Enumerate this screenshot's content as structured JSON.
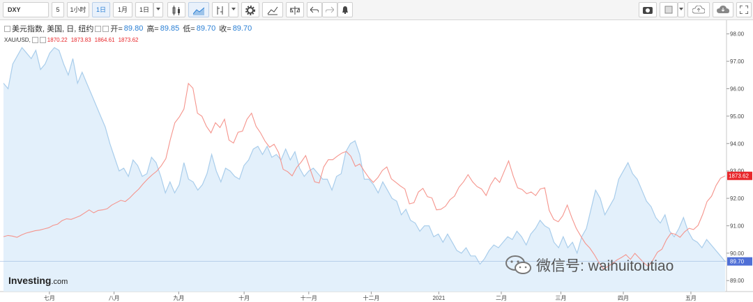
{
  "toolbar": {
    "symbol": "DXY",
    "buttons": [
      "5",
      "1小时",
      "1日",
      "1月",
      "1日"
    ]
  },
  "legend": {
    "dxy_name": "美元指数, 美国, 日, 纽约",
    "dxy_open_label": "开=",
    "dxy_open": "89.80",
    "dxy_high_label": "高=",
    "dxy_high": "89.85",
    "dxy_low_label": "低=",
    "dxy_low": "89.70",
    "dxy_close_label": "收=",
    "dxy_close": "89.70",
    "xau_name": "XAU/USD,",
    "xau_open": "1870.22",
    "xau_high": "1873.83",
    "xau_low": "1864.61",
    "xau_close": "1873.62"
  },
  "watermark": "微信号: waihuitoutiao",
  "logo": {
    "main": "Investing",
    "suffix": ".com"
  },
  "colors": {
    "dxy_line": "#a9cdeb",
    "dxy_fill": "#e3f0fb",
    "xau_line": "#f5948c",
    "dxy_tag": "#4f6fd6",
    "xau_tag": "#e8262a",
    "accent": "#2a7fd4"
  },
  "chart_data": {
    "type": "area",
    "x_labels": [
      "七月",
      "八月",
      "九月",
      "十月",
      "十一月",
      "十二月",
      "2021",
      "二月",
      "三月",
      "四月",
      "五月"
    ],
    "yaxis_ticks": [
      "98.00",
      "97.00",
      "96.00",
      "95.00",
      "94.00",
      "93.00",
      "92.00",
      "91.00",
      "90.00",
      "89.00"
    ],
    "ylim": [
      88.6,
      98.5
    ],
    "current_tags": {
      "dxy": "89.70",
      "xau": "1873.62"
    },
    "series": [
      {
        "name": "美元指数",
        "type": "area",
        "axis": "right",
        "values": [
          96.2,
          96.0,
          96.9,
          97.2,
          97.5,
          97.3,
          97.1,
          97.4,
          96.7,
          96.9,
          97.3,
          97.5,
          97.4,
          96.9,
          96.5,
          97.1,
          96.2,
          96.6,
          96.2,
          95.8,
          95.4,
          95.0,
          94.6,
          94.0,
          93.5,
          93.0,
          93.1,
          92.8,
          93.4,
          93.2,
          92.8,
          92.9,
          93.5,
          93.3,
          92.8,
          92.2,
          92.6,
          92.2,
          92.5,
          93.3,
          92.7,
          92.6,
          92.3,
          92.5,
          92.9,
          93.6,
          93.0,
          92.6,
          93.1,
          93.0,
          92.8,
          92.7,
          93.2,
          93.4,
          93.8,
          93.9,
          93.6,
          93.9,
          93.5,
          93.6,
          93.4,
          93.8,
          93.4,
          93.7,
          93.1,
          92.8,
          93.0,
          93.1,
          92.9,
          92.7,
          92.7,
          92.3,
          92.8,
          92.9,
          93.7,
          94.0,
          94.1,
          93.6,
          92.7,
          92.7,
          92.5,
          92.2,
          92.6,
          92.3,
          92.0,
          91.9,
          91.4,
          91.6,
          91.2,
          91.1,
          90.8,
          91.0,
          91.0,
          90.6,
          90.7,
          90.4,
          90.7,
          90.4,
          90.1,
          90.0,
          90.2,
          89.9,
          89.9,
          89.6,
          89.8,
          90.1,
          90.3,
          90.2,
          90.4,
          90.6,
          90.5,
          90.8,
          90.6,
          90.3,
          90.7,
          90.9,
          91.2,
          91.0,
          90.9,
          90.4,
          90.2,
          90.6,
          90.2,
          90.4,
          90.0,
          90.6,
          90.9,
          91.6,
          92.3,
          92.0,
          91.4,
          91.7,
          92.0,
          92.7,
          93.0,
          93.3,
          92.9,
          92.7,
          92.3,
          91.9,
          91.7,
          91.3,
          91.1,
          91.4,
          90.8,
          90.6,
          90.9,
          91.3,
          90.8,
          90.5,
          90.4,
          90.2,
          90.5,
          90.3,
          90.1,
          89.9,
          89.7
        ]
      },
      {
        "name": "XAU/USD",
        "type": "line",
        "axis": "right-scaled",
        "values": [
          1771,
          1773,
          1772,
          1770,
          1774,
          1777,
          1779,
          1781,
          1782,
          1784,
          1786,
          1790,
          1792,
          1798,
          1801,
          1800,
          1803,
          1806,
          1811,
          1816,
          1811,
          1815,
          1816,
          1818,
          1824,
          1828,
          1832,
          1830,
          1836,
          1844,
          1851,
          1860,
          1868,
          1875,
          1881,
          1890,
          1902,
          1934,
          1962,
          1972,
          1985,
          2028,
          2020,
          1978,
          1973,
          1956,
          1945,
          1962,
          1954,
          1968,
          1933,
          1928,
          1946,
          1948,
          1968,
          1978,
          1956,
          1945,
          1931,
          1921,
          1926,
          1912,
          1884,
          1880,
          1873,
          1887,
          1896,
          1907,
          1884,
          1863,
          1861,
          1888,
          1900,
          1900,
          1906,
          1911,
          1914,
          1906,
          1889,
          1893,
          1881,
          1870,
          1862,
          1870,
          1882,
          1888,
          1868,
          1862,
          1856,
          1851,
          1826,
          1828,
          1846,
          1852,
          1838,
          1836,
          1816,
          1817,
          1822,
          1833,
          1839,
          1854,
          1863,
          1875,
          1863,
          1855,
          1851,
          1840,
          1858,
          1870,
          1862,
          1880,
          1898,
          1873,
          1853,
          1850,
          1843,
          1846,
          1840,
          1851,
          1853,
          1815,
          1800,
          1796,
          1806,
          1824,
          1803,
          1785,
          1772,
          1760,
          1752,
          1741,
          1728,
          1717,
          1721,
          1726,
          1732,
          1736,
          1741,
          1733,
          1743,
          1735,
          1727,
          1721,
          1732,
          1745,
          1750,
          1766,
          1777,
          1775,
          1770,
          1779,
          1785,
          1783,
          1790,
          1808,
          1830,
          1839,
          1857,
          1869,
          1873
        ]
      }
    ]
  }
}
